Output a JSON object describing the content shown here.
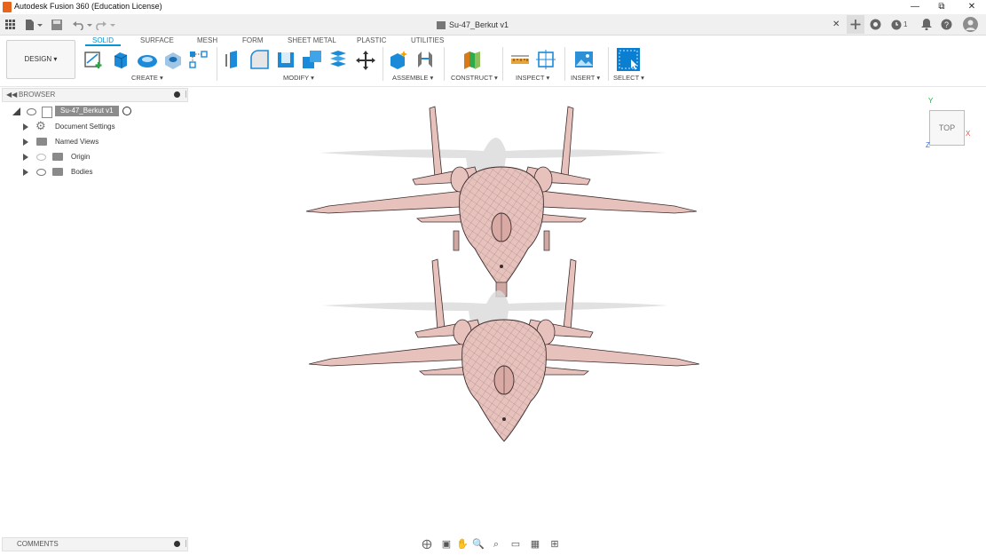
{
  "window": {
    "title": "Autodesk Fusion 360 (Education License)",
    "controls": [
      "minimize",
      "restore",
      "close"
    ]
  },
  "appbar": {
    "document_tab": "Su-47_Berkut v1",
    "job_count": "1"
  },
  "ribbon": {
    "workspace": "DESIGN",
    "tabs": [
      "SOLID",
      "SURFACE",
      "MESH",
      "FORM",
      "SHEET METAL",
      "PLASTIC",
      "UTILITIES"
    ],
    "active_tab": "SOLID",
    "groups": [
      "CREATE",
      "MODIFY",
      "ASSEMBLE",
      "CONSTRUCT",
      "INSPECT",
      "INSERT",
      "SELECT"
    ]
  },
  "browser": {
    "title": "BROWSER",
    "root": "Su-47_Berkut v1",
    "items": [
      "Document Settings",
      "Named Views",
      "Origin",
      "Bodies"
    ]
  },
  "comments": {
    "title": "COMMENTS"
  },
  "viewcube": {
    "face": "TOP",
    "axes": [
      "Y",
      "X",
      "Z"
    ]
  },
  "colors": {
    "accent": "#0696d7",
    "model_fill": "#e7c2bd",
    "model_edge": "#3d2c2c",
    "shadow": "#d6d6d6"
  }
}
